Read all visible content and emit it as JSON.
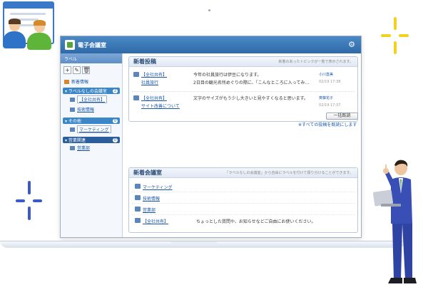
{
  "app": {
    "title": "電子会議室",
    "settings_icon": "gear-icon"
  },
  "sidebar": {
    "header": "ラベル",
    "tools": [
      "+",
      "✎",
      "🗑"
    ],
    "all_label": "新着情報",
    "groups": [
      {
        "label": "ラベルなしの会議室",
        "count": "2",
        "color": "#3b86c6",
        "items": [
          {
            "label": "【全社共有】"
          },
          {
            "label": "技術情報"
          }
        ]
      },
      {
        "label": "その他",
        "count": "0",
        "color": "#3b86c6",
        "items": [
          {
            "label": "マーケティング"
          }
        ]
      },
      {
        "label": "営業関連",
        "count": "0",
        "color": "#2a5e9c",
        "items": [
          {
            "label": "営業部"
          }
        ]
      }
    ]
  },
  "new_posts": {
    "title": "新着投稿",
    "note": "新着のあったトピックが一覧で表示されます。",
    "items": [
      {
        "room": "【全社共有】",
        "topic": "社員旅行",
        "line1": "今年の社員旅行は伊豆になります。",
        "line2": "2日目の観光名所めぐりの際に、「こんなところに入ってみ…",
        "author": "小川直美",
        "date": "02/19 17:38"
      },
      {
        "room": "【全社共有】",
        "topic": "サイト改善について",
        "line1": "文字のサイズがもう少し大きいと見やすくなると思います。",
        "line2": "",
        "author": "斉藤花子",
        "date": "02/19 17:37"
      }
    ],
    "mark_read_button": "一括既読",
    "mark_all_link": "※すべての投稿を既読にします"
  },
  "new_rooms": {
    "title": "新着会議室",
    "note": "「ラベルなしの会議室」から自由にラベルを付けて振り分けることができます。",
    "items": [
      {
        "name": "マーケティング",
        "desc": ""
      },
      {
        "name": "技術情報",
        "desc": ""
      },
      {
        "name": "営業部",
        "desc": ""
      },
      {
        "name": "【全社共有】",
        "desc": "ちょっとした質問や、お知らせなどご自由にお使いください。"
      }
    ]
  },
  "colors": {
    "header_blue": "#2f6aa8",
    "link_blue": "#1a57a6",
    "sparkle_yellow": "#f2d21b",
    "sparkle_blue": "#3a5bc7"
  }
}
